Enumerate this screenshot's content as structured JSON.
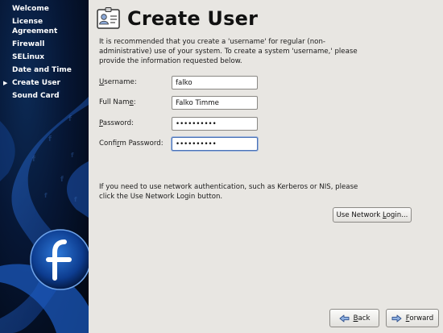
{
  "sidebar": {
    "items": [
      {
        "label": "Welcome",
        "current": false
      },
      {
        "label": "License Agreement",
        "current": false
      },
      {
        "label": "Firewall",
        "current": false
      },
      {
        "label": "SELinux",
        "current": false
      },
      {
        "label": "Date and Time",
        "current": false
      },
      {
        "label": "Create User",
        "current": true
      },
      {
        "label": "Sound Card",
        "current": false
      }
    ],
    "current_marker": "▶"
  },
  "page": {
    "title": "Create User",
    "intro": "It is recommended that you create a 'username' for regular (non-administrative) use of your system. To create a system 'username,' please provide the information requested below."
  },
  "form": {
    "username_label_pre": "",
    "username_label_u": "U",
    "username_label_post": "sername:",
    "username_value": "falko",
    "fullname_label_pre": "Full Nam",
    "fullname_label_u": "e",
    "fullname_label_post": ":",
    "fullname_value": "Falko Timme",
    "password_label_pre": "",
    "password_label_u": "P",
    "password_label_post": "assword:",
    "password_value": "••••••••••",
    "confirm_label_pre": "Confi",
    "confirm_label_u": "r",
    "confirm_label_post": "m Password:",
    "confirm_value": "••••••••••"
  },
  "network": {
    "info": "If you need to use network authentication, such as Kerberos or NIS, please click the Use Network Login button.",
    "button_pre": "Use Network ",
    "button_u": "L",
    "button_post": "ogin..."
  },
  "footer": {
    "back_u": "B",
    "back_post": "ack",
    "forward_u": "F",
    "forward_post": "orward"
  },
  "icons": {
    "title": "user-card-icon",
    "back": "back-arrow-icon",
    "forward": "forward-arrow-icon"
  }
}
